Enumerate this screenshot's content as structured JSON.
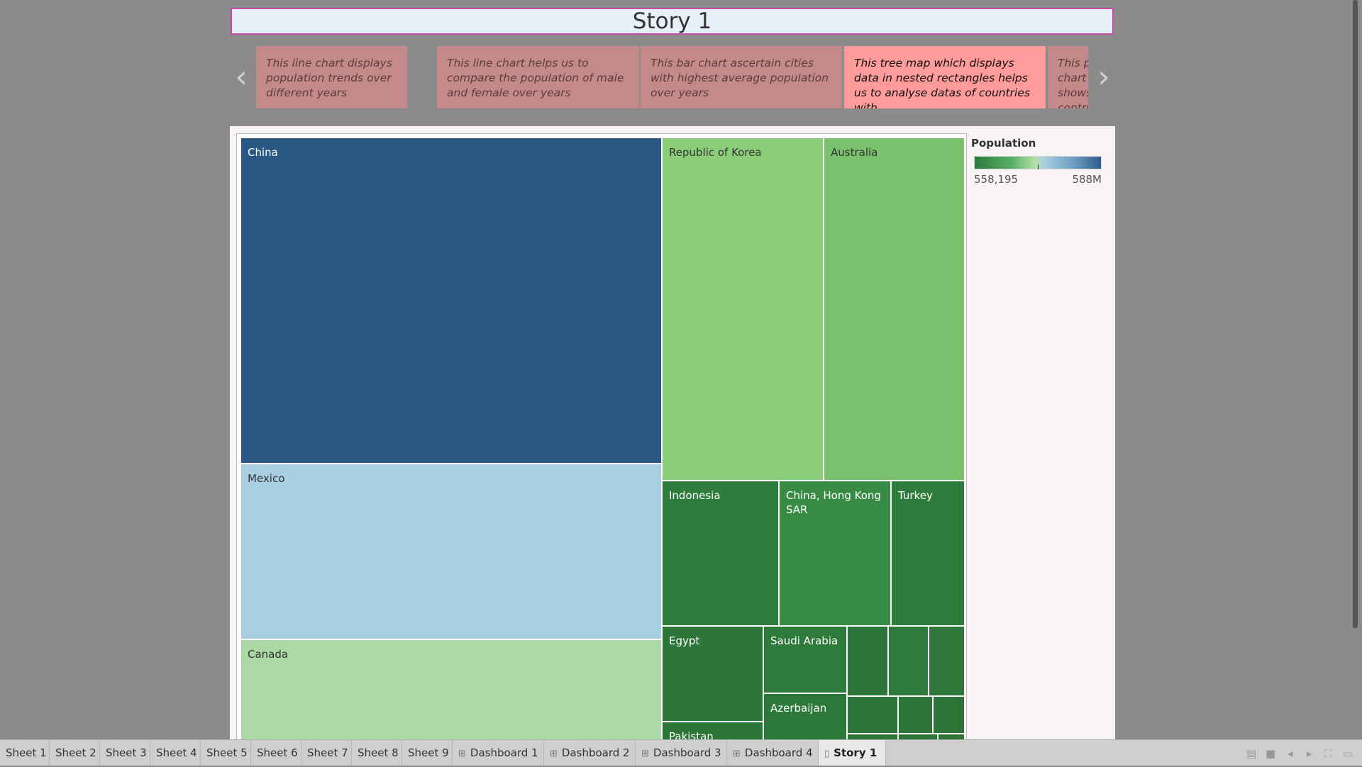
{
  "story": {
    "title": "Story 1"
  },
  "nav": {
    "prev_icon": "chevron-left-icon",
    "next_icon": "chevron-right-icon",
    "prev_glyph": "‹",
    "next_glyph": "›"
  },
  "story_points": [
    {
      "text": "This line chart displays population trends over different years"
    },
    {
      "text": "This line chart helps us to compare the population of male and female over years"
    },
    {
      "text": "This bar chart ascertain cities with highest average population over years"
    },
    {
      "text": "This tree map which displays data in nested rectangles  helps us to analyse datas of countries with"
    },
    {
      "text": "This pie chart shows the contribution of population"
    }
  ],
  "treemap": {
    "cells": [
      {
        "label": "China",
        "color": "#2a5783"
      },
      {
        "label": "Mexico",
        "color": "#a9cedf"
      },
      {
        "label": "Canada",
        "color": "#acd8a3"
      },
      {
        "label": "Republic of Korea",
        "color": "#8bcd78"
      },
      {
        "label": "Australia",
        "color": "#7bc16d"
      },
      {
        "label": "Indonesia",
        "color": "#2f7d3d"
      },
      {
        "label": "China, Hong Kong SAR",
        "color": "#388b44"
      },
      {
        "label": "Turkey",
        "color": "#2e7d3c"
      },
      {
        "label": "Egypt",
        "color": "#2c7738"
      },
      {
        "label": "Saudi Arabia",
        "color": "#2e7a3a"
      },
      {
        "label": "Azerbaijan",
        "color": "#2c7839"
      },
      {
        "label": "Pakistan",
        "color": "#2b7536"
      },
      {
        "label": "",
        "color": "#2d7639"
      },
      {
        "label": "",
        "color": "#2e7a3a"
      },
      {
        "label": "",
        "color": "#2d7839"
      },
      {
        "label": "",
        "color": "#2c7538"
      },
      {
        "label": "",
        "color": "#2d7639"
      },
      {
        "label": "",
        "color": "#2b7436"
      },
      {
        "label": "",
        "color": "#2c7537"
      },
      {
        "label": "",
        "color": "#2b7436"
      },
      {
        "label": "",
        "color": "#2c7537"
      }
    ]
  },
  "legend": {
    "title": "Population",
    "min_label": "558,195",
    "max_label": "588M"
  },
  "tabs": [
    {
      "label": "Sheet 1",
      "icon": ""
    },
    {
      "label": "Sheet 2",
      "icon": ""
    },
    {
      "label": "Sheet 3",
      "icon": ""
    },
    {
      "label": "Sheet 4",
      "icon": ""
    },
    {
      "label": "Sheet 5",
      "icon": ""
    },
    {
      "label": "Sheet 6",
      "icon": ""
    },
    {
      "label": "Sheet 7",
      "icon": ""
    },
    {
      "label": "Sheet 8",
      "icon": ""
    },
    {
      "label": "Sheet 9",
      "icon": ""
    },
    {
      "label": "Dashboard 1",
      "icon": "dashboard-icon"
    },
    {
      "label": "Dashboard 2",
      "icon": "dashboard-icon"
    },
    {
      "label": "Dashboard 3",
      "icon": "dashboard-icon"
    },
    {
      "label": "Dashboard 4",
      "icon": "dashboard-icon"
    },
    {
      "label": "Story 1",
      "icon": "story-icon",
      "active": true
    }
  ],
  "controls": [
    "sheet-sorter-icon",
    "filmstrip-icon",
    "previous-sheet-icon",
    "next-sheet-icon",
    "fullscreen-icon",
    "presentation-icon"
  ]
}
